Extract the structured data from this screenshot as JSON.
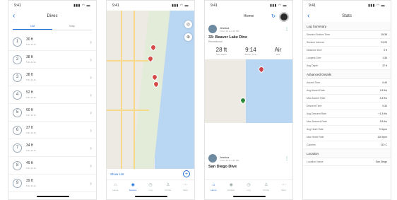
{
  "status_time": "9:41",
  "phone1": {
    "title": "Dives",
    "tabs": [
      "List",
      "Map"
    ],
    "dives": [
      {
        "num": "1",
        "depth": "30 ft",
        "sub": "5:41   11:11"
      },
      {
        "num": "2",
        "depth": "38 ft",
        "sub": "5:41   11:11"
      },
      {
        "num": "3",
        "depth": "38 ft",
        "sub": "5:41   11:11"
      },
      {
        "num": "4",
        "depth": "52 ft",
        "sub": "5:41   11:11"
      },
      {
        "num": "5",
        "depth": "60 ft",
        "sub": "5:41   11:11"
      },
      {
        "num": "6",
        "depth": "37 ft",
        "sub": "5:41   11:11"
      },
      {
        "num": "7",
        "depth": "34 ft",
        "sub": "5:41   11:11"
      },
      {
        "num": "8",
        "depth": "49 ft",
        "sub": "5:41   11:11"
      },
      {
        "num": "9",
        "depth": "39 ft",
        "sub": "5:41   11:11"
      }
    ]
  },
  "phone2": {
    "show_list": "Show List",
    "tabs": [
      {
        "label": "Home",
        "icon": "house-icon"
      },
      {
        "label": "Explore",
        "icon": "compass-icon"
      },
      {
        "label": "Log",
        "icon": "clock-icon"
      },
      {
        "label": "Profile",
        "icon": "person-icon"
      },
      {
        "label": "More",
        "icon": "ellipsis-icon"
      }
    ]
  },
  "phone3": {
    "title": "Home",
    "user": "Jessica",
    "date": "2 Nov 23 at 4:10 PM",
    "dive_title": "33: Beaver Lake Dive",
    "dive_sub": "Recreational",
    "stats": [
      {
        "value": "28 ft",
        "label": "Max Depth"
      },
      {
        "value": "9:14",
        "label": "Bottom Time"
      },
      {
        "value": "Air",
        "label": "Gas"
      }
    ],
    "user2": "Jessica",
    "date2": "2 Nov 23 at 4:10 PM",
    "dive2_title": "San Diego Dive"
  },
  "phone4": {
    "title": "Stats",
    "log_summary": "Log Summary",
    "log_rows": [
      {
        "k": "Session Bottom Time",
        "v": "18:38"
      },
      {
        "k": "Surface Interval",
        "v": "23:29"
      },
      {
        "k": "Distance Dive",
        "v": "0 ft"
      },
      {
        "k": "Longest Dive",
        "v": "1:36"
      },
      {
        "k": "Avg Depth",
        "v": "37 ft"
      }
    ],
    "advanced": "Advanced Details",
    "adv_rows": [
      {
        "k": "Ascent Time",
        "v": "0:45"
      },
      {
        "k": "Avg Ascent Rate",
        "v": "1.8 ft/s"
      },
      {
        "k": "Max Ascent Rate",
        "v": "3.4 ft/s"
      },
      {
        "k": "Descent Time",
        "v": "0:30"
      },
      {
        "k": "Avg Descent Rate",
        "v": "+1.3 ft/s"
      },
      {
        "k": "Max Descent Rate",
        "v": "3.8 ft/s"
      },
      {
        "k": "Avg Heart Rate",
        "v": "74 bpm"
      },
      {
        "k": "Max Heart Rate",
        "v": "100 bpm"
      },
      {
        "k": "Calories",
        "v": "110 C"
      }
    ],
    "location": "Location",
    "location_row": {
      "k": "Location Name",
      "v": "San Diego"
    }
  }
}
